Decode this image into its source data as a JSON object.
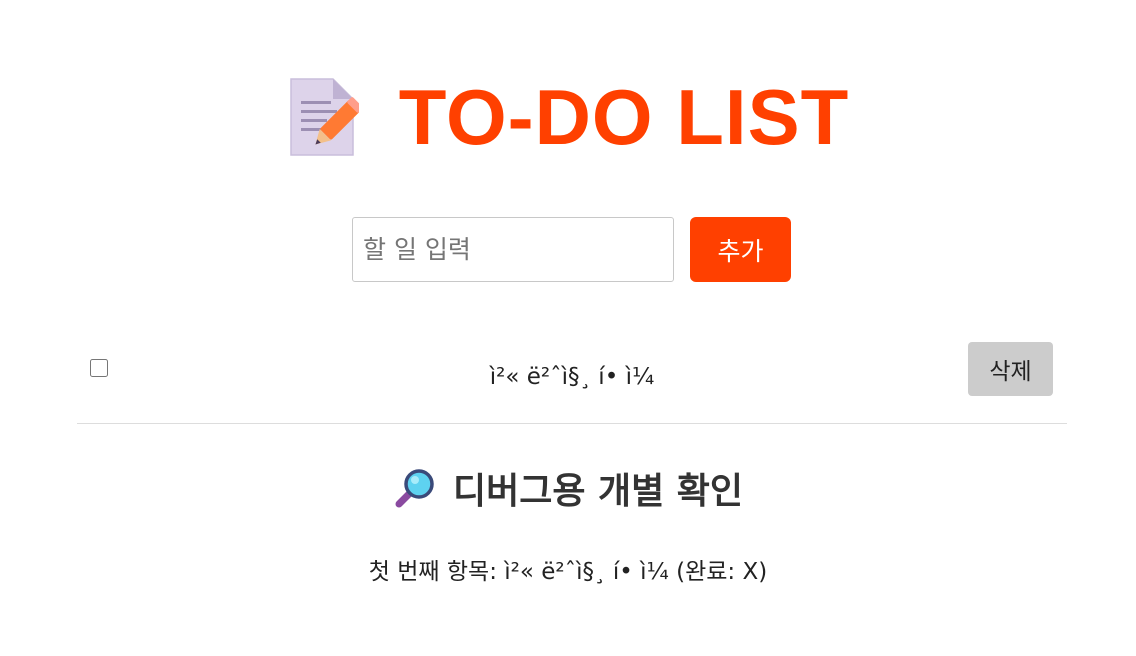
{
  "header": {
    "icon": "memo-pencil-icon",
    "title": "TO-DO LIST"
  },
  "form": {
    "placeholder": "할 일 입력",
    "value": "",
    "add_label": "추가"
  },
  "todos": [
    {
      "text": "ì²« ë²ˆì§¸ í•  ì¼",
      "done": false,
      "delete_label": "삭제"
    }
  ],
  "debug": {
    "icon": "magnifying-glass-icon",
    "heading": "디버그용 개별 확인",
    "first_item_line": "첫 번째 항목: ì²« ë²ˆì§¸ í•  ì¼ (완료: X)"
  },
  "colors": {
    "accent": "#ff4000",
    "delete_button": "#cccccc",
    "divider": "#dddddd"
  }
}
